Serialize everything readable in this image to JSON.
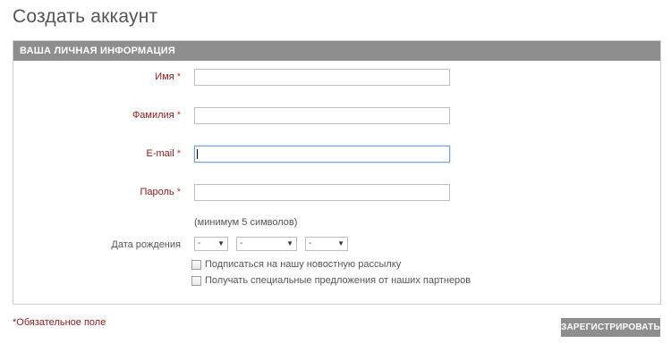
{
  "page": {
    "title": "Создать аккаунт"
  },
  "section": {
    "header": "ВАША ЛИЧНАЯ ИНФОРМАЦИЯ"
  },
  "required_marker": "*",
  "fields": {
    "first_name": {
      "label": "Имя",
      "value": ""
    },
    "last_name": {
      "label": "Фамилия",
      "value": ""
    },
    "email": {
      "label": "E-mail",
      "value": ""
    },
    "password": {
      "label": "Пароль",
      "value": "",
      "hint": "(минимум 5 символов)"
    }
  },
  "birth_date": {
    "label": "Дата рождения",
    "day": "-",
    "month": "-",
    "year": "-"
  },
  "checkboxes": {
    "newsletter": {
      "label": "Подписаться на нашу новостную рассылку",
      "checked": false
    },
    "partners": {
      "label": "Получать специальные предложения от наших партнеров",
      "checked": false
    }
  },
  "footer": {
    "required_note": "*Обязательное поле",
    "submit_label": "ЗАРЕГИСТРИРОВАТЬ"
  },
  "colors": {
    "header_bg": "#8e8e8e",
    "label_red": "#8b1a1a",
    "focus_border": "#7da2ce"
  }
}
